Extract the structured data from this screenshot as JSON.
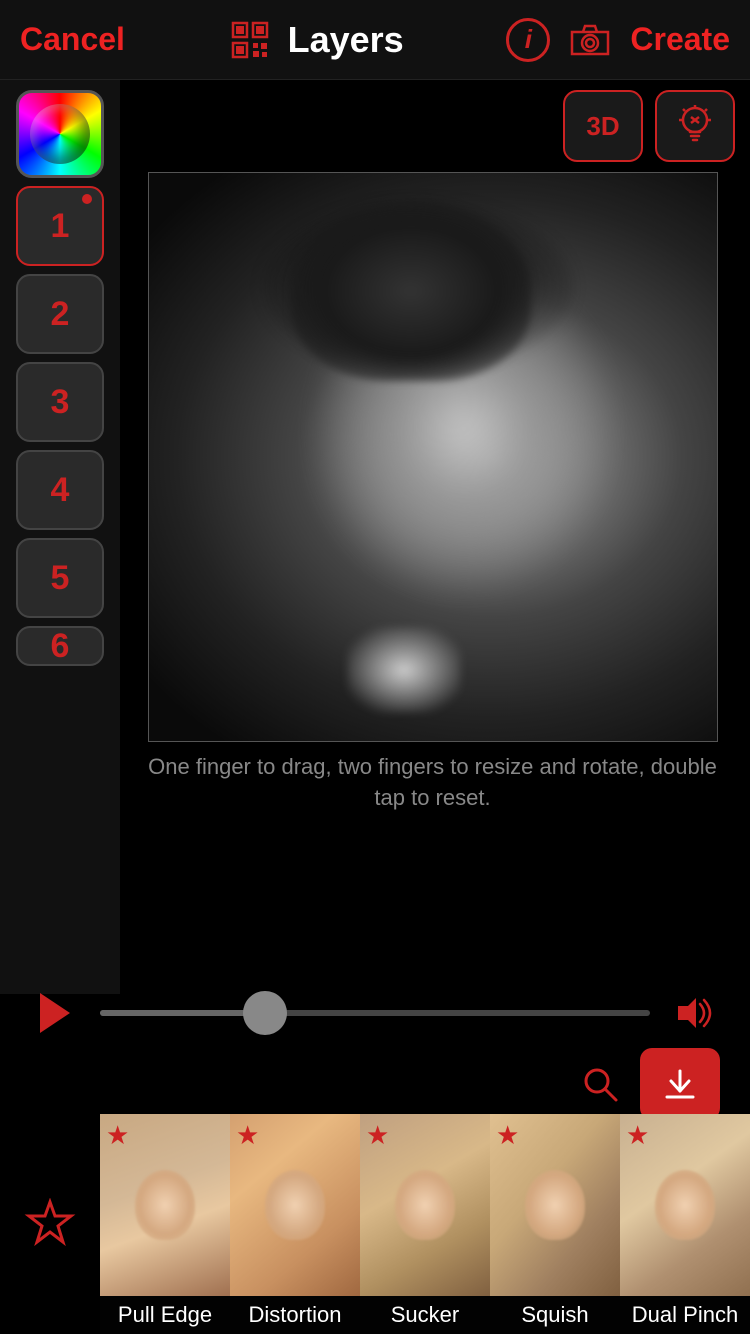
{
  "header": {
    "cancel_label": "Cancel",
    "title": "Layers",
    "create_label": "Create"
  },
  "sidebar": {
    "layers": [
      {
        "id": 1,
        "label": "1",
        "active": true,
        "has_dot": true
      },
      {
        "id": 2,
        "label": "2",
        "active": false,
        "has_dot": false
      },
      {
        "id": 3,
        "label": "3",
        "active": false,
        "has_dot": false
      },
      {
        "id": 4,
        "label": "4",
        "active": false,
        "has_dot": false
      },
      {
        "id": 5,
        "label": "5",
        "active": false,
        "has_dot": false
      },
      {
        "id": 6,
        "label": "6",
        "active": false,
        "has_dot": false
      }
    ]
  },
  "top_buttons": {
    "three_d_label": "3D",
    "bulb_label": "✕"
  },
  "canvas": {
    "hint": "One finger to drag, two fingers to resize and rotate, double tap to reset."
  },
  "effects": {
    "items": [
      {
        "label": "Pull Edge",
        "thumb_class": "thumb-pull-edge"
      },
      {
        "label": "Distortion",
        "thumb_class": "thumb-distortion"
      },
      {
        "label": "Sucker",
        "thumb_class": "thumb-sucker"
      },
      {
        "label": "Squish",
        "thumb_class": "thumb-squish"
      },
      {
        "label": "Dual Pinch",
        "thumb_class": "thumb-dual-pinch"
      }
    ]
  },
  "icons": {
    "play": "▶",
    "volume": "🔊",
    "search": "🔍",
    "star_outline": "☆",
    "star_filled": "★",
    "chevron_down": "▼",
    "info": "i",
    "bulb": "💡",
    "close": "✕"
  }
}
